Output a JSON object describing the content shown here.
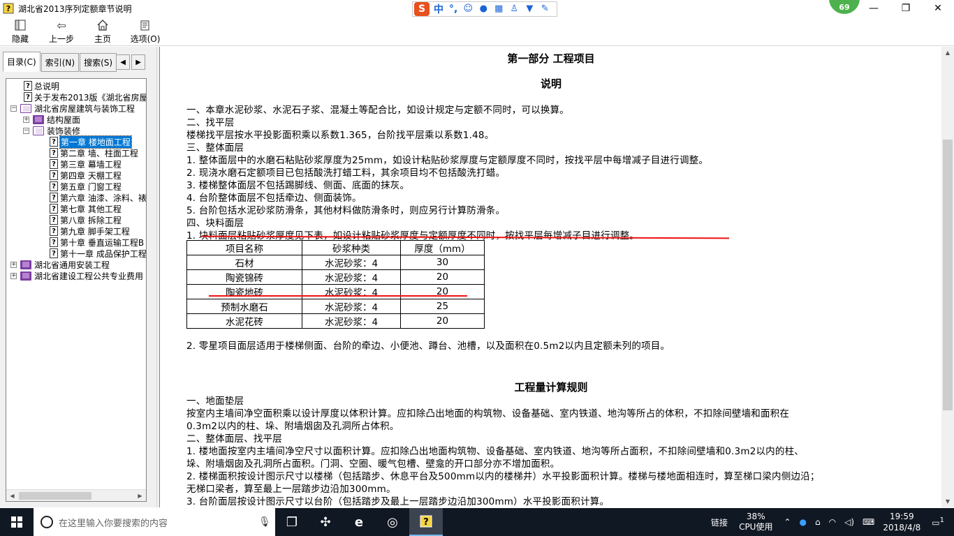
{
  "window": {
    "title": "湖北省2013序列定额章节说明",
    "minimize": "—",
    "maximize": "❐",
    "close": "✕"
  },
  "ime": {
    "logo": "S",
    "mode": "中",
    "punct": "°,"
  },
  "badge": "69",
  "toolbar": {
    "hide_label": "隐藏",
    "back_label": "上一步",
    "home_label": "主页",
    "options_label": "选项(O)"
  },
  "tabs": {
    "contents": "目录(C)",
    "index": "索引(N)",
    "search": "搜索(S)"
  },
  "tree": [
    {
      "label": "总说明",
      "type": "topic"
    },
    {
      "label": "关于发布2013版《湖北省房屋",
      "type": "topic"
    },
    {
      "label": "湖北省房屋建筑与装饰工程",
      "type": "book-open"
    },
    {
      "label": "结构屋面",
      "type": "book"
    },
    {
      "label": "装饰装修",
      "type": "book-open"
    },
    {
      "label": "第一章  楼地面工程",
      "type": "topic"
    },
    {
      "label": "第二章  墙、柱面工程",
      "type": "topic"
    },
    {
      "label": "第三章  幕墙工程",
      "type": "topic"
    },
    {
      "label": "第四章  天棚工程",
      "type": "topic"
    },
    {
      "label": "第五章  门窗工程",
      "type": "topic"
    },
    {
      "label": "第六章  油漆、涂料、裱",
      "type": "topic"
    },
    {
      "label": "第七章  其他工程",
      "type": "topic"
    },
    {
      "label": "第八章  拆除工程",
      "type": "topic"
    },
    {
      "label": "第九章  脚手架工程",
      "type": "topic"
    },
    {
      "label": "第十章  垂直运输工程B",
      "type": "topic"
    },
    {
      "label": "第十一章  成品保护工程",
      "type": "topic"
    },
    {
      "label": "湖北省通用安装工程",
      "type": "book"
    },
    {
      "label": "湖北省建设工程公共专业费用",
      "type": "book"
    }
  ],
  "doc": {
    "part_title": "第一部分  工程项目",
    "section_title": "说明",
    "lines1": [
      "一、本章水泥砂浆、水泥石子浆、混凝土等配合比，如设计规定与定额不同时，可以换算。",
      "二、找平层",
      "楼梯找平层按水平投影面积乘以系数1.365，台阶找平层乘以系数1.48。",
      "三、整体面层",
      "1. 整体面层中的水磨石粘贴砂浆厚度为25mm，如设计粘贴砂浆厚度与定额厚度不同时，按找平层中每增减子目进行调整。",
      "2. 现浇水磨石定额项目已包括酸洗打蜡工料，其余项目均不包括酸洗打蜡。",
      "3. 楼梯整体面层不包括踢脚线、侧面、底面的抹灰。",
      "4. 台阶整体面层不包括牵边、侧面装饰。",
      "5. 台阶包括水泥砂浆防滑条，其他材料做防滑条时，则应另行计算防滑条。",
      "四、块料面层",
      "1. 块料面层粘贴砂浆厚度见下表，如设计粘贴砂浆厚度与定额厚度不同时，按找平层每增减子目进行调整。"
    ],
    "table_headers": [
      "项目名称",
      "砂浆种类",
      "厚度（mm）"
    ],
    "table_rows": [
      [
        "石材",
        "水泥砂浆：4",
        "30"
      ],
      [
        "陶瓷锦砖",
        "水泥砂浆：4",
        "20"
      ],
      [
        "陶瓷地砖",
        "水泥砂浆：4",
        "20"
      ],
      [
        "预制水磨石",
        "水泥砂浆：4",
        "25"
      ],
      [
        "水泥花砖",
        "水泥砂浆：4",
        "20"
      ]
    ],
    "line_after_table": "2. 零星项目面层适用于楼梯侧面、台阶的牵边、小便池、蹲台、池槽，以及面积在0.5m2以内且定额未列的项目。",
    "rules_title": "工程量计算规则",
    "lines2": [
      "一、地面垫层",
      "按室内主墙间净空面积乘以设计厚度以体积计算。应扣除凸出地面的构筑物、设备基础、室内铁道、地沟等所占的体积，不扣除间壁墙和面积在",
      "0.3m2以内的柱、垛、附墙烟囱及孔洞所占体积。",
      "二、整体面层、找平层",
      "1. 楼地面按室内主墙间净空尺寸以面积计算。应扣除凸出地面构筑物、设备基础、室内铁道、地沟等所占面积，不扣除间壁墙和0.3m2以内的柱、",
      "垛、附墙烟囱及孔洞所占面积。门洞、空圈、暖气包槽、壁龛的开口部分亦不增加面积。",
      "2. 楼梯面积按设计图示尺寸以楼梯（包括踏步、休息平台及500mm以内的楼梯井）水平投影面积计算。楼梯与楼地面相连时，算至梯口梁内侧边沿；",
      "无梯口梁者，算至最上一层踏步边沿加300mm。",
      "3. 台阶面层按设计图示尺寸以台阶（包括踏步及最上一层踏步边沿加300mm）水平投影面积计算。"
    ]
  },
  "taskbar": {
    "search_placeholder": "在这里输入你要搜索的内容",
    "link_label": "链接",
    "cpu_percent": "38%",
    "cpu_label": "CPU使用",
    "time": "19:59",
    "date": "2018/4/8",
    "notif_count": "1"
  }
}
